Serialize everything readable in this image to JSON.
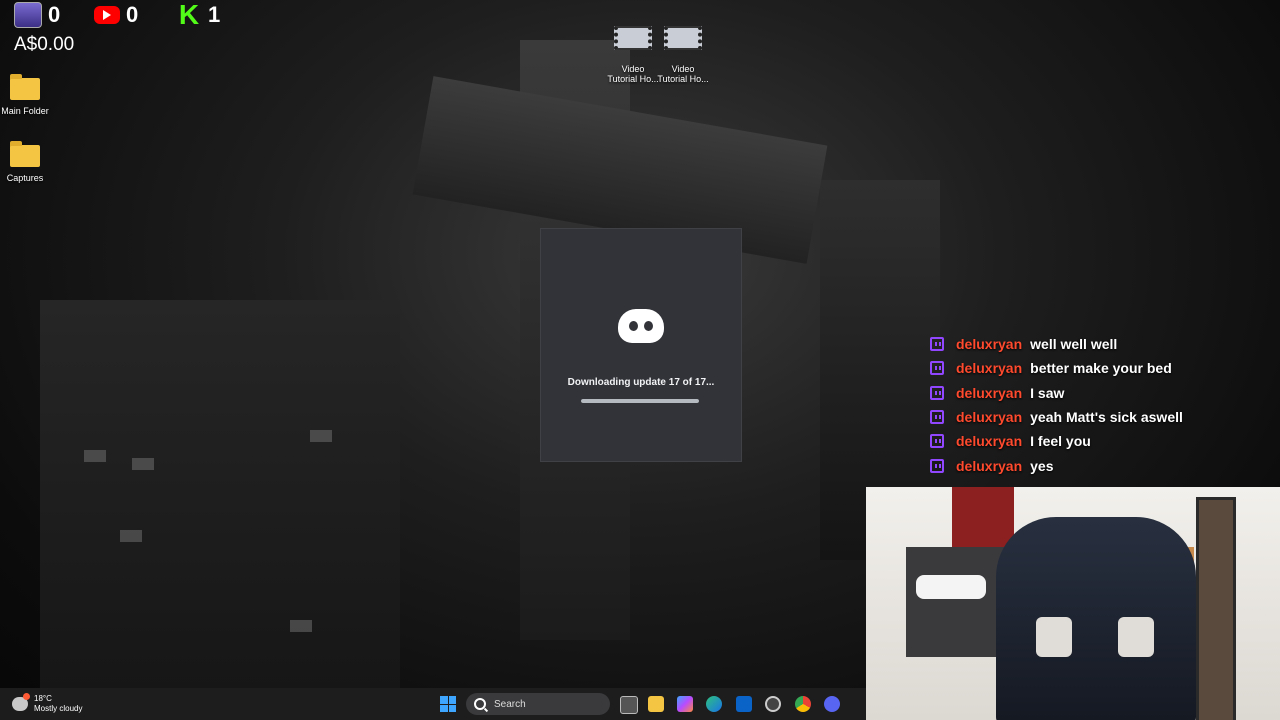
{
  "stream_overlay": {
    "tips_count": "0",
    "youtube_count": "0",
    "kick_icon_letter": "K",
    "kick_count": "1",
    "money": "A$0.00"
  },
  "desktop": {
    "icons": [
      {
        "label": "Main Folder",
        "icon": "folder-icon"
      },
      {
        "label": "Captures",
        "icon": "folder-icon"
      },
      {
        "label": "Video\nTutorial Ho...",
        "icon": "video-file-icon"
      },
      {
        "label": "Video\nTutorial Ho...",
        "icon": "video-file-icon"
      }
    ]
  },
  "discord_updater": {
    "status": "Downloading update 17 of 17...",
    "progress": 1.0
  },
  "chat": {
    "messages": [
      {
        "user": "deluxryan",
        "text": "well well well"
      },
      {
        "user": "deluxryan",
        "text": "better make your bed"
      },
      {
        "user": "deluxryan",
        "text": "I saw"
      },
      {
        "user": "deluxryan",
        "text": "yeah Matt's sick aswell"
      },
      {
        "user": "deluxryan",
        "text": "I feel you"
      },
      {
        "user": "deluxryan",
        "text": "yes"
      }
    ]
  },
  "taskbar": {
    "weather_temp": "18°C",
    "weather_desc": "Mostly cloudy",
    "search_placeholder": "Search"
  },
  "colors": {
    "chat_user": "#ff4a2e",
    "twitch_purple": "#9146ff",
    "discord_bg": "#313338",
    "kick_green": "#53fc18"
  }
}
